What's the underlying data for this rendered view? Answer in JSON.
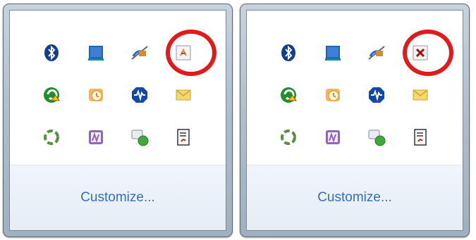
{
  "flyouts": [
    {
      "customize_label": "Customize...",
      "icons": [
        "bluetooth-icon",
        "network-adapter-icon",
        "satellite-dish-icon",
        "java-update-icon",
        "restore-arrow-icon",
        "outlook-clock-icon",
        "voice-wave-icon",
        "mail-envelope-icon",
        "recycle-icon",
        "onenote-clip-icon",
        "chat-bubble-green-icon",
        "document-notes-icon"
      ],
      "highlighted_icon": "java-update-icon"
    },
    {
      "customize_label": "Customize...",
      "icons": [
        "bluetooth-icon",
        "network-adapter-icon",
        "satellite-dish-icon",
        "error-x-icon",
        "restore-arrow-icon",
        "outlook-clock-icon",
        "voice-wave-icon",
        "mail-envelope-icon",
        "recycle-icon",
        "onenote-clip-icon",
        "chat-bubble-green-icon",
        "document-notes-icon"
      ],
      "highlighted_icon": "error-x-icon"
    }
  ],
  "colors": {
    "highlight_ring": "#e11b1b",
    "link": "#2f6fc2"
  }
}
